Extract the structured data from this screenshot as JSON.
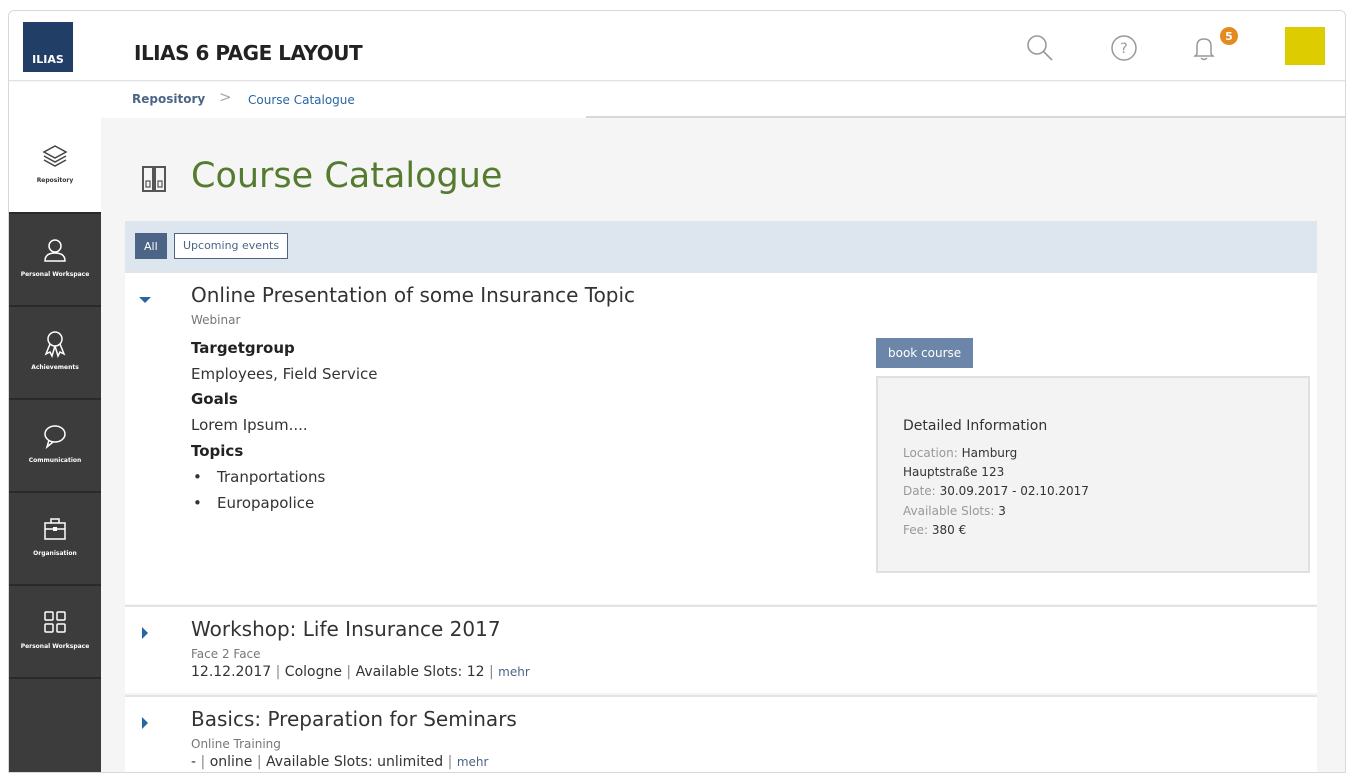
{
  "header": {
    "logo_text": "ILIAS",
    "title": "ILIAS 6 PAGE LAYOUT",
    "notification_count": "5",
    "colors": {
      "logo_bg": "#213e66",
      "badge": "#e58a1f",
      "avatar": "#ddcc00"
    }
  },
  "breadcrumb": {
    "items": [
      "Repository",
      "Course Catalogue"
    ],
    "separator": ">"
  },
  "sidebar": {
    "items": [
      {
        "label": "Repository",
        "icon": "layers-icon",
        "active": true
      },
      {
        "label": "Personal Workspace",
        "icon": "person-icon"
      },
      {
        "label": "Achievements",
        "icon": "award-icon"
      },
      {
        "label": "Communication",
        "icon": "speech-bubble-icon"
      },
      {
        "label": "Organisation",
        "icon": "briefcase-icon"
      },
      {
        "label": "Personal Workspace",
        "icon": "grid-icon"
      }
    ]
  },
  "page": {
    "title": "Course Catalogue",
    "title_color": "#557b2e",
    "view_controls": [
      "All",
      "Upcoming events"
    ]
  },
  "items": [
    {
      "title": "Online Presentation of some Insurance Topic",
      "type": "Webinar",
      "expanded": true,
      "properties": {
        "targetgroup_label": "Targetgroup",
        "targetgroup_value": "Employees, Field Service",
        "goals_label": "Goals",
        "goals_value": "Lorem Ipsum....",
        "topics_label": "Topics",
        "topics": [
          "Tranportations",
          "Europapolice"
        ]
      },
      "book_button": "book course",
      "details": {
        "title": "Detailed Information",
        "location_label": "Location:",
        "location_value": "Hamburg",
        "address": "Hauptstraße 123",
        "date_label": "Date:",
        "date_value": "30.09.2017 - 02.10.2017",
        "slots_label": "Available Slots:",
        "slots_value": "3",
        "fee_label": "Fee:",
        "fee_value": "380 €"
      }
    },
    {
      "title": "Workshop: Life Insurance 2017",
      "type": "Face 2 Face",
      "expanded": false,
      "date": "12.12.2017",
      "location": "Cologne",
      "slots": "Available Slots: 12",
      "more": "mehr"
    },
    {
      "title": "Basics: Preparation for Seminars",
      "type": "Online Training",
      "expanded": false,
      "date": "-",
      "location": "online",
      "slots": "Available Slots: unlimited",
      "more": "mehr"
    }
  ]
}
